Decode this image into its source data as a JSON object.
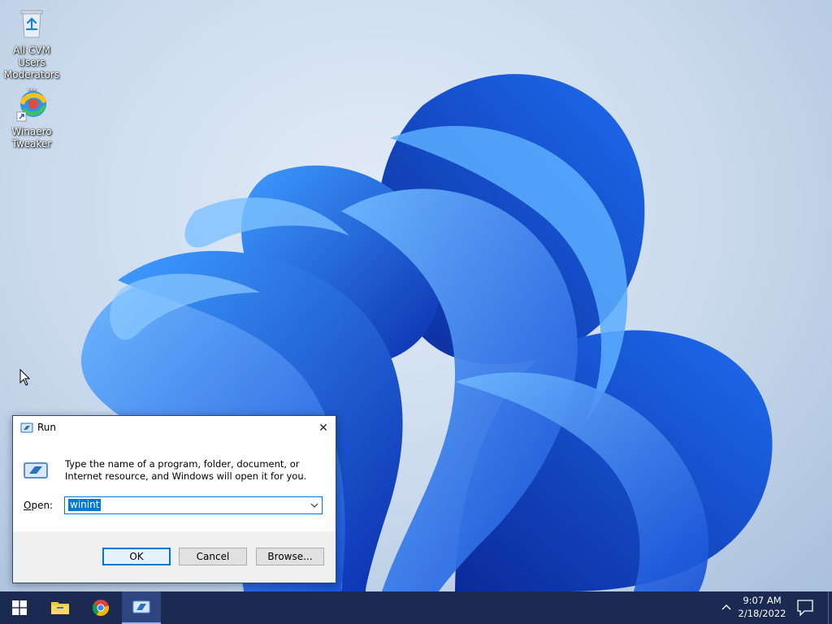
{
  "desktop": {
    "icons": [
      {
        "label": "All CVM Users Moderators ...",
        "icon": "recycle-bin-icon"
      },
      {
        "label": "Winaero Tweaker",
        "icon": "winaero-tweaker-icon"
      }
    ]
  },
  "run_dialog": {
    "title": "Run",
    "description": "Type the name of a program, folder, document, or Internet resource, and Windows will open it for you.",
    "open_label_accel": "O",
    "open_label_rest": "pen:",
    "input_value": "winint",
    "buttons": {
      "ok": "OK",
      "cancel": "Cancel",
      "browse": "Browse..."
    },
    "close_glyph": "✕"
  },
  "taskbar": {
    "items": [
      {
        "name": "start",
        "icon": "windows-logo-icon"
      },
      {
        "name": "file-explorer",
        "icon": "folder-icon"
      },
      {
        "name": "chrome",
        "icon": "chrome-icon"
      },
      {
        "name": "run",
        "icon": "run-icon",
        "active": true
      }
    ],
    "clock_time": "9:07 AM",
    "clock_date": "2/18/2022"
  },
  "colors": {
    "accent": "#0078d7",
    "taskbar": "#1b2a50",
    "wallpaper_blue": "#1a5fe0"
  }
}
